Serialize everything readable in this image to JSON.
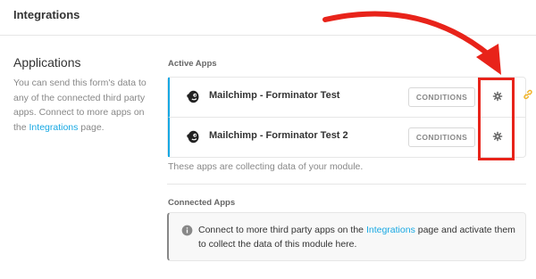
{
  "header": {
    "title": "Integrations"
  },
  "applications": {
    "heading": "Applications",
    "desc_before": "You can send this form's data to any of the connected third party apps. Connect to more apps on the ",
    "desc_link": "Integrations",
    "desc_after": " page."
  },
  "active_apps": {
    "label": "Active Apps",
    "items": [
      {
        "name": "Mailchimp - Forminator Test",
        "conditions_label": "CONDITIONS",
        "icon": "mailchimp-icon"
      },
      {
        "name": "Mailchimp - Forminator Test 2",
        "conditions_label": "CONDITIONS",
        "icon": "mailchimp-icon"
      }
    ],
    "note": "These apps are collecting data of your module."
  },
  "connected_apps": {
    "label": "Connected Apps",
    "notice_before": "Connect to more third party apps on the ",
    "notice_link": "Integrations",
    "notice_after": " page and activate them to collect the data of this module here."
  },
  "colors": {
    "accent": "#17a8e3",
    "annotation": "#e8231a",
    "link_icon": "#f0b429"
  }
}
